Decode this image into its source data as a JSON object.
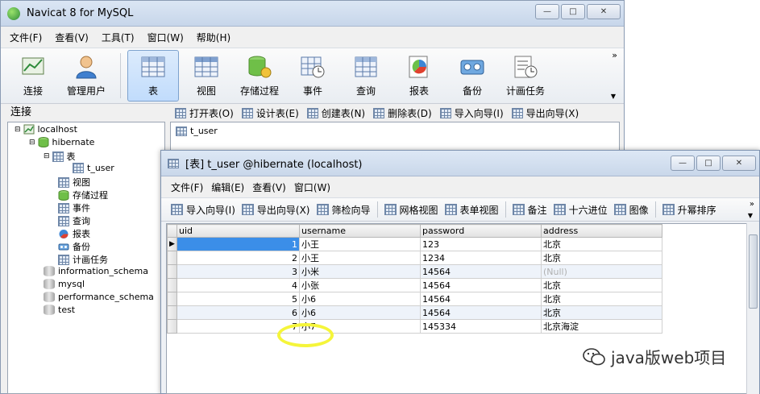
{
  "main_window": {
    "title": "Navicat 8 for MySQL",
    "menu": [
      "文件(F)",
      "查看(V)",
      "工具(T)",
      "窗口(W)",
      "帮助(H)"
    ],
    "toolbar": [
      {
        "label": "连接",
        "icon": "connect-icon"
      },
      {
        "label": "管理用户",
        "icon": "user-icon"
      },
      {
        "label": "表",
        "icon": "table-icon",
        "active": true
      },
      {
        "label": "视图",
        "icon": "view-icon"
      },
      {
        "label": "存储过程",
        "icon": "procedure-icon"
      },
      {
        "label": "事件",
        "icon": "event-icon"
      },
      {
        "label": "查询",
        "icon": "query-icon"
      },
      {
        "label": "报表",
        "icon": "report-icon"
      },
      {
        "label": "备份",
        "icon": "backup-icon"
      },
      {
        "label": "计画任务",
        "icon": "schedule-icon"
      }
    ],
    "more_glyph": "»",
    "left_panel_title": "连接",
    "tree": [
      {
        "label": "localhost"
      },
      {
        "label": "hibernate"
      },
      {
        "label": "表"
      },
      {
        "label": "t_user"
      },
      {
        "label": "视图"
      },
      {
        "label": "存储过程"
      },
      {
        "label": "事件"
      },
      {
        "label": "查询"
      },
      {
        "label": "报表"
      },
      {
        "label": "备份"
      },
      {
        "label": "计画任务"
      },
      {
        "label": "information_schema"
      },
      {
        "label": "mysql"
      },
      {
        "label": "performance_schema"
      },
      {
        "label": "test"
      }
    ],
    "object_toolbar": [
      "打开表(O)",
      "设计表(E)",
      "创建表(N)",
      "删除表(D)",
      "导入向导(I)",
      "导出向导(X)"
    ],
    "objects": [
      "t_user"
    ]
  },
  "table_window": {
    "title": "[表] t_user @hibernate (localhost)",
    "menu": [
      "文件(F)",
      "编辑(E)",
      "查看(V)",
      "窗口(W)"
    ],
    "toolbar": [
      "导入向导(I)",
      "导出向导(X)",
      "筛检向导",
      "网格视图",
      "表单视图",
      "备注",
      "十六进位",
      "图像",
      "升幂排序"
    ],
    "columns": [
      "uid",
      "username",
      "password",
      "address"
    ],
    "rows": [
      {
        "uid": "1",
        "username": "小王",
        "password": "123",
        "address": "北京"
      },
      {
        "uid": "2",
        "username": "小王",
        "password": "1234",
        "address": "北京"
      },
      {
        "uid": "3",
        "username": "小米",
        "password": "14564",
        "address": "(Null)"
      },
      {
        "uid": "4",
        "username": "小张",
        "password": "14564",
        "address": "北京"
      },
      {
        "uid": "5",
        "username": "小6",
        "password": "14564",
        "address": "北京"
      },
      {
        "uid": "6",
        "username": "小6",
        "password": "14564",
        "address": "北京"
      },
      {
        "uid": "7",
        "username": "小7",
        "password": "145334",
        "address": "北京海淀"
      }
    ],
    "current_row_marker": "▶"
  },
  "watermark": "java版web项目",
  "colors": {
    "selection": "#3b8ee8",
    "highlight": "#f5f53a"
  }
}
